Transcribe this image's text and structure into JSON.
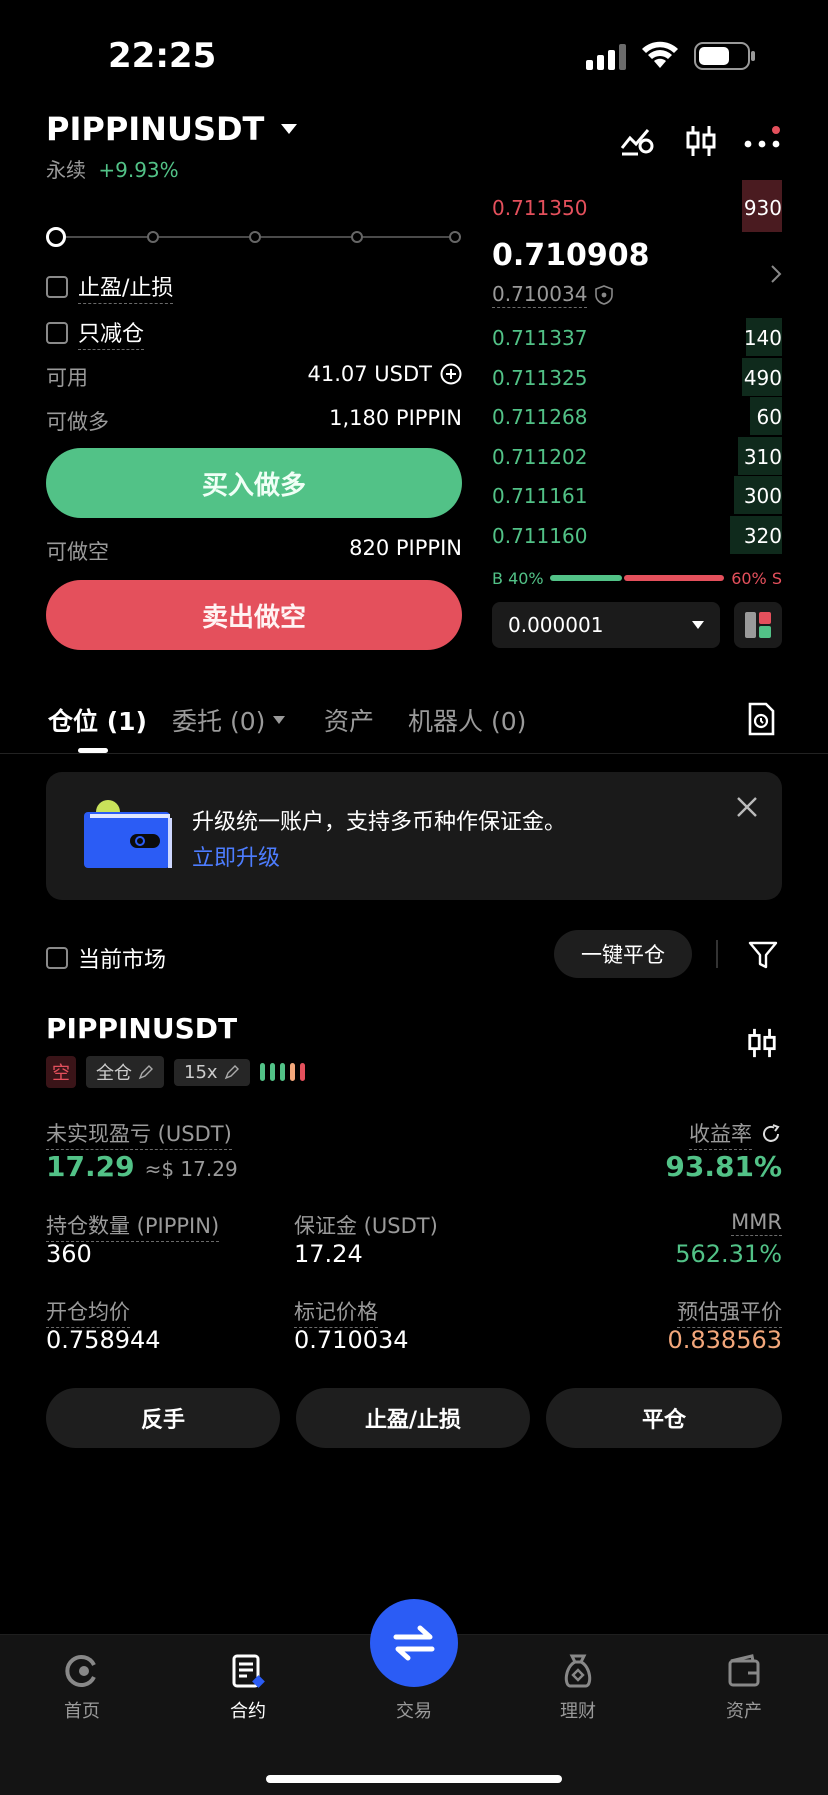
{
  "status_bar": {
    "time": "22:25"
  },
  "header": {
    "symbol": "PIPPINUSDT",
    "contract_type": "永续",
    "change": "+9.93%"
  },
  "order_form": {
    "tp_sl_label": "止盈/止损",
    "reduce_only_label": "只减仓",
    "available_label": "可用",
    "available_value": "41.07 USDT",
    "can_long_label": "可做多",
    "can_long_value": "1,180 PIPPIN",
    "buy_button": "买入做多",
    "can_short_label": "可做空",
    "can_short_value": "820 PIPPIN",
    "sell_button": "卖出做空",
    "leverage_slider_level": 0
  },
  "orderbook": {
    "asks": [
      {
        "price": "0.711350",
        "qty": "930"
      }
    ],
    "last_price": "0.710908",
    "mark_price": "0.710034",
    "bids": [
      {
        "price": "0.711337",
        "qty": "140"
      },
      {
        "price": "0.711325",
        "qty": "490"
      },
      {
        "price": "0.711268",
        "qty": "60"
      },
      {
        "price": "0.711202",
        "qty": "310"
      },
      {
        "price": "0.711161",
        "qty": "300"
      },
      {
        "price": "0.711160",
        "qty": "320"
      }
    ],
    "buy_ratio_label": "B 40%",
    "sell_ratio_label": "60% S",
    "buy_ratio": 0.4,
    "precision": "0.000001"
  },
  "tabs": [
    {
      "label": "仓位 (1)"
    },
    {
      "label": "委托 (0)"
    },
    {
      "label": "资产"
    },
    {
      "label": "机器人 (0)"
    }
  ],
  "banner": {
    "text": "升级统一账户，支持多币种作保证金。",
    "link": "立即升级"
  },
  "filter": {
    "current_market": "当前市场",
    "close_all": "一键平仓"
  },
  "position": {
    "symbol": "PIPPINUSDT",
    "side": "空",
    "margin_mode": "全仓",
    "leverage": "15x",
    "unrealized_pnl_label": "未实现盈亏 (USDT)",
    "unrealized_pnl": "17.29",
    "unrealized_pnl_usd": "≈$ 17.29",
    "roe_label": "收益率",
    "roe": "93.81%",
    "qty_label": "持仓数量 (PIPPIN)",
    "qty": "360",
    "margin_label": "保证金 (USDT)",
    "margin": "17.24",
    "mmr_label": "MMR",
    "mmr": "562.31%",
    "entry_label": "开仓均价",
    "entry": "0.758944",
    "mark_label": "标记价格",
    "mark": "0.710034",
    "liq_label": "预估强平价",
    "liq": "0.838563",
    "actions": {
      "reverse": "反手",
      "tpsl": "止盈/止损",
      "close": "平仓"
    }
  },
  "bottom_nav": [
    {
      "label": "首页"
    },
    {
      "label": "合约"
    },
    {
      "label": "交易"
    },
    {
      "label": "理财"
    },
    {
      "label": "资产"
    }
  ],
  "colors": {
    "green": "#52c287",
    "red": "#e4505c",
    "accent_blue": "#2b5cf5",
    "orange": "#f3a77b"
  }
}
